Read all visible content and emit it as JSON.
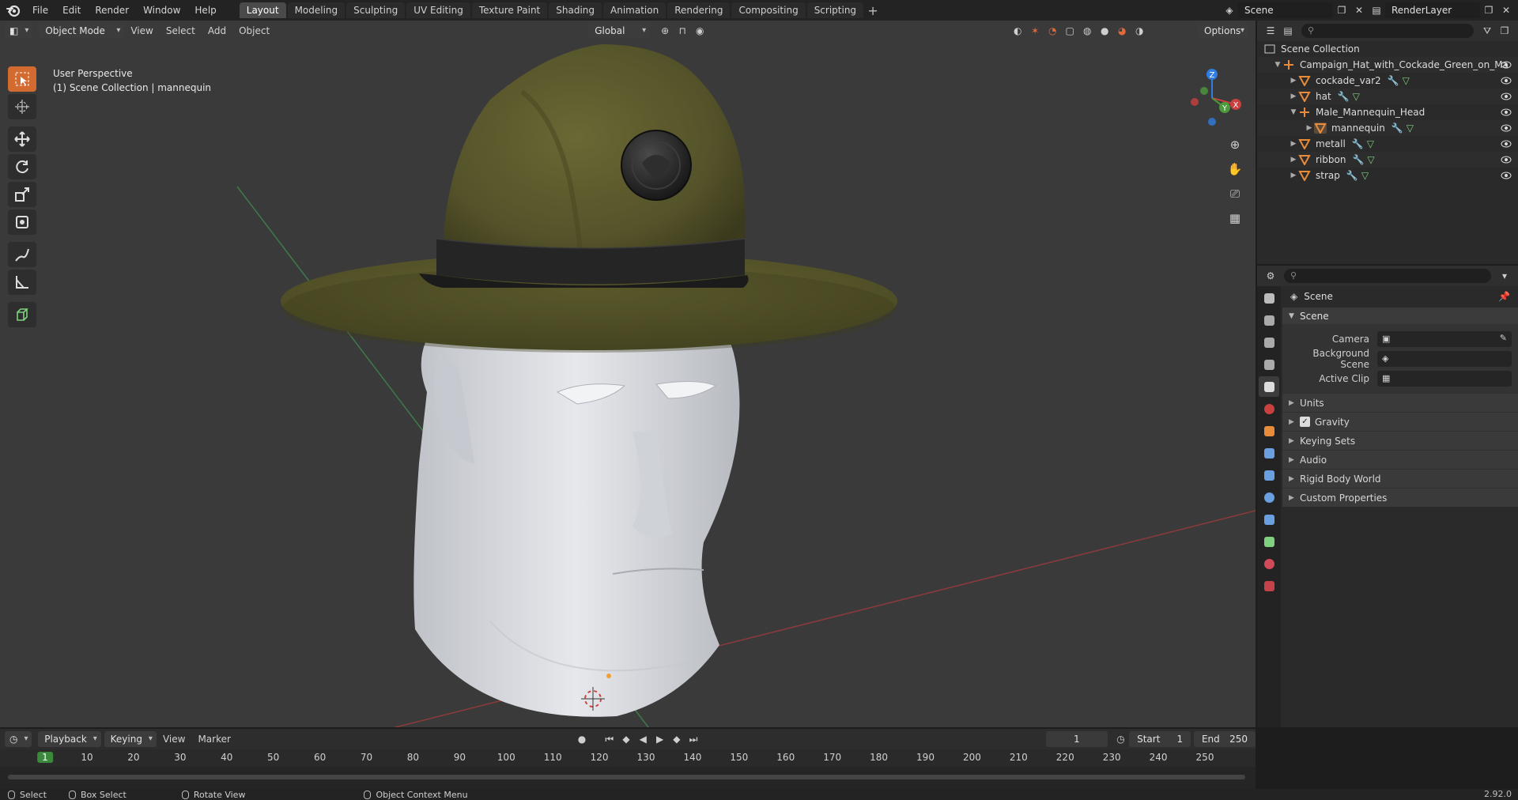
{
  "topbar": {
    "menus": [
      "File",
      "Edit",
      "Render",
      "Window",
      "Help"
    ],
    "workspaces": [
      "Layout",
      "Modeling",
      "Sculpting",
      "UV Editing",
      "Texture Paint",
      "Shading",
      "Animation",
      "Rendering",
      "Compositing",
      "Scripting"
    ],
    "active_workspace": "Layout",
    "scene_name": "Scene",
    "view_layer": "RenderLayer"
  },
  "viewport": {
    "mode": "Object Mode",
    "menus": [
      "View",
      "Select",
      "Add",
      "Object"
    ],
    "orientation": "Global",
    "options_label": "Options",
    "perspective_label": "User Perspective",
    "collection_label": "(1) Scene Collection | mannequin",
    "gizmo_axes": {
      "x": "X",
      "y": "Y",
      "z": "Z"
    }
  },
  "outliner": {
    "root": "Scene Collection",
    "items": [
      {
        "name": "Campaign_Hat_with_Cockade_Green_on_Ma",
        "depth": 1,
        "type": "empty",
        "expanded": true
      },
      {
        "name": "cockade_var2",
        "depth": 2,
        "type": "mesh"
      },
      {
        "name": "hat",
        "depth": 2,
        "type": "mesh"
      },
      {
        "name": "Male_Mannequin_Head",
        "depth": 2,
        "type": "empty",
        "expanded": true
      },
      {
        "name": "mannequin",
        "depth": 3,
        "type": "mesh"
      },
      {
        "name": "metall",
        "depth": 2,
        "type": "mesh"
      },
      {
        "name": "ribbon",
        "depth": 2,
        "type": "mesh"
      },
      {
        "name": "strap",
        "depth": 2,
        "type": "mesh"
      }
    ]
  },
  "properties": {
    "context": "Scene",
    "scene_panel": {
      "title": "Scene",
      "fields": [
        {
          "label": "Camera",
          "value": ""
        },
        {
          "label": "Background Scene",
          "value": ""
        },
        {
          "label": "Active Clip",
          "value": ""
        }
      ]
    },
    "sub_panels": [
      "Units",
      "Gravity",
      "Keying Sets",
      "Audio",
      "Rigid Body World",
      "Custom Properties"
    ],
    "gravity_checked": true
  },
  "timeline": {
    "menus": [
      "Playback",
      "Keying",
      "View",
      "Marker"
    ],
    "current_frame": "1",
    "start_label": "Start",
    "start": "1",
    "end_label": "End",
    "end": "250",
    "ticks": [
      "1",
      "10",
      "20",
      "30",
      "40",
      "50",
      "60",
      "70",
      "80",
      "90",
      "100",
      "110",
      "120",
      "130",
      "140",
      "150",
      "160",
      "170",
      "180",
      "190",
      "200",
      "210",
      "220",
      "230",
      "240",
      "250"
    ]
  },
  "statusbar": {
    "items": [
      "Select",
      "Box Select",
      "Rotate View",
      "Object Context Menu"
    ],
    "version": "2.92.0"
  },
  "colors": {
    "accent": "#d36a30",
    "hat_felt": "#5b5a2c",
    "band": "#2a2a2a",
    "mannequin": "#d9dbe0",
    "background": "#393939",
    "axis_x": "#c9403f",
    "axis_y": "#4c9a3c",
    "axis_z": "#2f7de0"
  }
}
